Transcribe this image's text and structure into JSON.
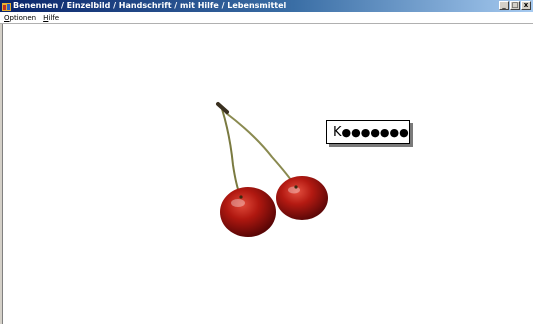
{
  "window": {
    "title": "Benennen / Einzelbild / Handschrift / mit Hilfe / Lebensmittel",
    "controls": {
      "minimize": "_",
      "maximize": "□",
      "close": "x"
    }
  },
  "menu": [
    {
      "label": "Optionen"
    },
    {
      "label": "Hilfe"
    }
  ],
  "picture": {
    "subject": "cherries-icon"
  },
  "word_prompt": {
    "first_letter": "K",
    "hidden_letters": "●●●●●●●"
  }
}
